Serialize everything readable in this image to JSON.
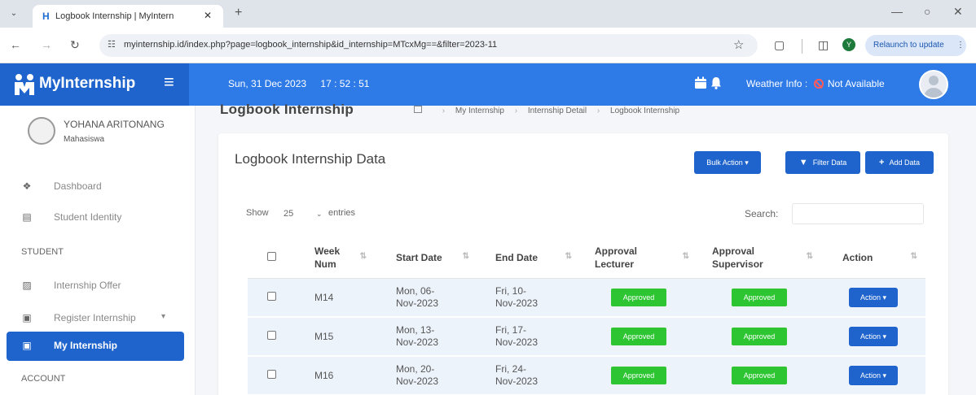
{
  "browser": {
    "tab_title": "Logbook Internship | MyIntern",
    "favicon": "H",
    "url": "myinternship.id/index.php?page=logbook_internship&id_internship=MTcxMg==&filter=2023-11",
    "relaunch_label": "Relaunch to update",
    "profile_initial": "Y"
  },
  "topbar": {
    "brand": "MyInternship",
    "date": "Sun, 31 Dec 2023",
    "time": "17 : 52 : 51",
    "weather_label": "Weather Info :",
    "weather_value": "Not Available",
    "color_primary": "#2e7be8",
    "color_brand": "#1f64cc"
  },
  "sidebar": {
    "user_name": "YOHANA ARITONANG",
    "user_role": "Mahasiswa",
    "items": [
      {
        "label": "Dashboard",
        "icon": "home-icon"
      },
      {
        "label": "Student Identity",
        "icon": "id-card-icon"
      }
    ],
    "section_student": "STUDENT",
    "student_items": [
      {
        "label": "Internship Offer",
        "icon": "building-icon"
      },
      {
        "label": "Register Internship",
        "icon": "form-icon"
      },
      {
        "label": "My Internship",
        "icon": "briefcase-icon"
      }
    ],
    "section_account": "ACCOUNT"
  },
  "page": {
    "title": "Logbook Internship",
    "breadcrumb": [
      "My Internship",
      "Internship Detail",
      "Logbook Internship"
    ]
  },
  "card": {
    "title": "Logbook Internship Data",
    "bulk_action": "Bulk Action",
    "filter_data": "Filter Data",
    "add_data": "Add Data",
    "show_label": "Show",
    "show_value": "25",
    "entries_label": "entries",
    "search_label": "Search:"
  },
  "table": {
    "headers": {
      "week_1": "Week",
      "week_2": "Num",
      "start": "Start Date",
      "end": "End Date",
      "lect_1": "Approval",
      "lect_2": "Lecturer",
      "sup_1": "Approval",
      "sup_2": "Supervisor",
      "action": "Action"
    },
    "rows": [
      {
        "week": "M14",
        "start_1": "Mon, 06-",
        "start_2": "Nov-2023",
        "end_1": "Fri, 10-",
        "end_2": "Nov-2023",
        "lecturer": "Approved",
        "supervisor": "Approved",
        "action": "Action"
      },
      {
        "week": "M15",
        "start_1": "Mon, 13-",
        "start_2": "Nov-2023",
        "end_1": "Fri, 17-",
        "end_2": "Nov-2023",
        "lecturer": "Approved",
        "supervisor": "Approved",
        "action": "Action"
      },
      {
        "week": "M16",
        "start_1": "Mon, 20-",
        "start_2": "Nov-2023",
        "end_1": "Fri, 24-",
        "end_2": "Nov-2023",
        "lecturer": "Approved",
        "supervisor": "Approved",
        "action": "Action"
      }
    ],
    "color_approved": "#2dc632",
    "color_row": "#edf3fb"
  }
}
